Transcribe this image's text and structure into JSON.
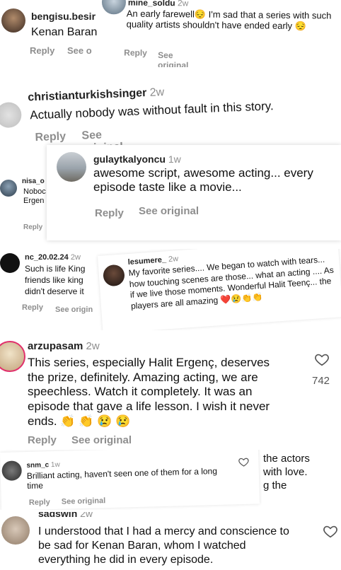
{
  "comments": {
    "c1": {
      "user": "bengisu.besir",
      "text": "Kenan Baran",
      "reply": "Reply",
      "see": "See o"
    },
    "c2": {
      "user": "mine_soldu",
      "time": "2w",
      "text": "An early farewell😔 I'm sad that a series with such quality artists shouldn't have ended early 😔",
      "reply": "Reply",
      "see": "See original"
    },
    "c3": {
      "user": "christianturkishsinger",
      "time": "2w",
      "text": "Actually nobody was without fault in this story.",
      "reply": "Reply",
      "see": "See original"
    },
    "c4": {
      "user": "gulaytkalyoncu",
      "time": "1w",
      "text": "awesome script, awesome acting... every episode taste like a movie...",
      "reply": "Reply",
      "see": "See original"
    },
    "c5": {
      "user": "nisa_o",
      "text1": "Noboc",
      "text2": "Ergen",
      "reply": "Reply"
    },
    "c6": {
      "user": "nc_20.02.24",
      "time": "2w",
      "text1": "Such is life King",
      "text2": "friends like king",
      "text3": "didn't deserve it",
      "reply": "Reply",
      "see": "See origin"
    },
    "c7": {
      "user": "lesumere_",
      "time": "2w",
      "text": "My favorite series.... We began to watch with tears... how touching scenes are those... what an acting .... As if we live those moments. Wonderful Halit Teenç... the players are all amazing ❤️😢👏👏"
    },
    "c8": {
      "user": "arzupasam",
      "time": "2w",
      "text": "This series, especially Halit Ergenç, deserves the prize, definitely. Amazing acting, we are speechless. Watch it completely. It was an episode that gave a life lesson. I wish it never ends. 👏 👏 😢 😢",
      "likes": "742",
      "reply": "Reply",
      "see": "See original"
    },
    "c9": {
      "user": "snm_c",
      "time": "1w",
      "text": "Brilliant acting, haven't seen one of them for a long time",
      "reply": "Reply",
      "see": "See original"
    },
    "c10": {
      "text1": "the actors",
      "text2": "with love.",
      "text3": "g the"
    },
    "c11": {
      "user": "sadswin",
      "time": "2w",
      "text": "I understood that I had a mercy and conscience to be sad for Kenan Baran, whom I watched everything he did in every episode."
    }
  }
}
